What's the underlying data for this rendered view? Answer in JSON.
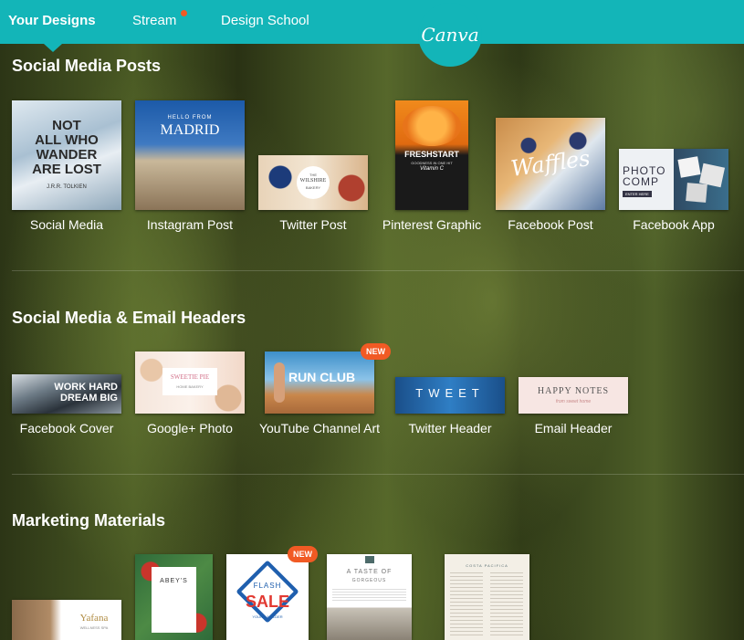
{
  "nav": {
    "your_designs": "Your Designs",
    "stream": "Stream",
    "design_school": "Design School",
    "logo_text": "Canva"
  },
  "sections": {
    "social_posts": {
      "title": "Social Media Posts",
      "items": [
        {
          "label": "Social Media",
          "thumb_lines": [
            "NOT",
            "ALL WHO",
            "WANDER",
            "ARE LOST"
          ],
          "thumb_sub": "J.R.R. TOLKIEN"
        },
        {
          "label": "Instagram Post",
          "thumb_small": "HELLO FROM",
          "thumb_big": "MADRID"
        },
        {
          "label": "Twitter Post",
          "thumb_small": "THE",
          "thumb_big": "WILSHIRE",
          "thumb_sub": "BAKERY"
        },
        {
          "label": "Pinterest Graphic",
          "thumb_big": "FRESHSTART",
          "thumb_small": "GOODNESS IN ONE HIT",
          "thumb_sub": "Vitamin C"
        },
        {
          "label": "Facebook Post",
          "thumb_big": "Waffles"
        },
        {
          "label": "Facebook App",
          "thumb_lines": [
            "PHOTO",
            "COMP"
          ],
          "thumb_small": "ENTER HERE"
        }
      ]
    },
    "headers": {
      "title": "Social Media & Email Headers",
      "items": [
        {
          "label": "Facebook Cover",
          "thumb_lines": [
            "WORK HARD",
            "DREAM BIG"
          ]
        },
        {
          "label": "Google+ Photo",
          "thumb_big": "SWEETIE PIE",
          "thumb_small": "HOME BAKERY"
        },
        {
          "label": "YouTube Channel Art",
          "thumb_big": "RUN CLUB",
          "badge": "NEW"
        },
        {
          "label": "Twitter Header",
          "thumb_big": "TWEET"
        },
        {
          "label": "Email Header",
          "thumb_big": "HAPPY NOTES",
          "thumb_small": "from sweet home"
        }
      ]
    },
    "marketing": {
      "title": "Marketing Materials",
      "items": [
        {
          "thumb_big": "Yafana",
          "thumb_small": "WELLNESS SPA"
        },
        {
          "thumb_big": "ABEY'S"
        },
        {
          "thumb_lines": [
            "FLASH",
            "SALE"
          ],
          "thumb_small": "YOUNG & OLDER",
          "badge": "NEW"
        },
        {
          "thumb_small": "A TASTE OF",
          "thumb_sub": "GORGEOUS"
        },
        {
          "thumb_small": "COSTA PACIFICA"
        }
      ]
    }
  }
}
